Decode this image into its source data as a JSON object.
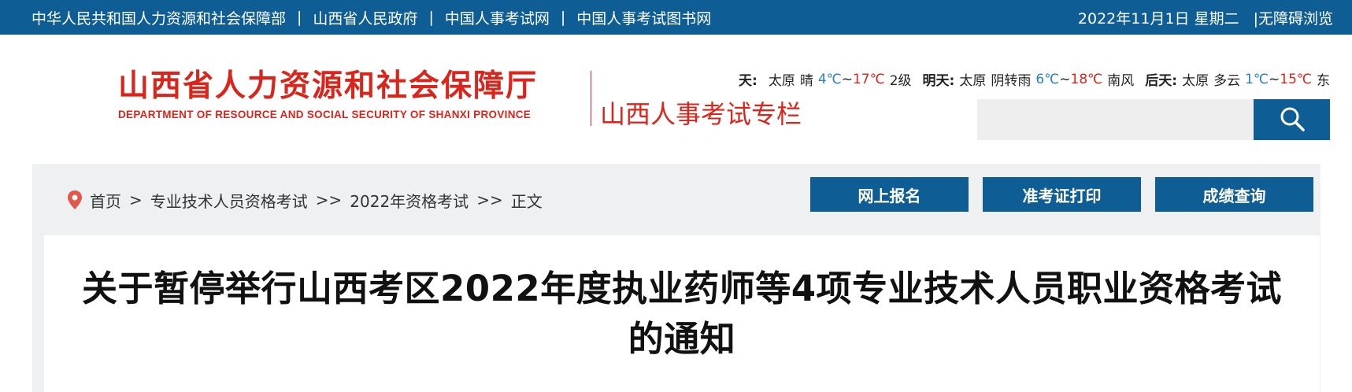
{
  "topbar": {
    "links": [
      "中华人民共和国人力资源和社会保障部",
      "山西省人民政府",
      "中国人事考试网",
      "中国人事考试图书网"
    ],
    "separator": "|",
    "date": "2022年11月1日 星期二",
    "accessibility": "|无障碍浏览"
  },
  "header": {
    "logo_cn": "山西省人力资源和社会保障厅",
    "logo_en": "DEPARTMENT OF RESOURCE AND SOCIAL SECURITY OF SHANXI PROVINCE",
    "logo_sub": "山西人事考试专栏",
    "weather": {
      "partial_label": "天:",
      "today": {
        "city": "太原",
        "cond": "晴",
        "low": "4℃",
        "tilde": "~",
        "high": "17℃",
        "wind": "2级"
      },
      "tomorrow": {
        "label": "明天:",
        "city": "太原",
        "cond": "阴转雨",
        "low": "6℃",
        "tilde": "~",
        "high": "18℃",
        "wind": "南风"
      },
      "after": {
        "label": "后天:",
        "city": "太原",
        "cond": "多云",
        "low": "1℃",
        "tilde": "~",
        "high": "15℃",
        "wind": "东"
      }
    },
    "search": {
      "placeholder": ""
    }
  },
  "breadcrumb": {
    "home": "首页",
    "arrow1": ">",
    "level1": "专业技术人员资格考试",
    "arrow2": ">>",
    "level2": "2022年资格考试",
    "arrow3": ">>",
    "current": "正文"
  },
  "quick_buttons": [
    "网上报名",
    "准考证打印",
    "成绩查询"
  ],
  "article": {
    "title": "关于暂停举行山西考区2022年度执业药师等4项专业技术人员职业资格考试的通知"
  },
  "colors": {
    "brand_blue": "#0e5d95",
    "brand_red": "#d9261c",
    "temp_low": "#2a7fc0",
    "band_gray": "#eef0f2"
  },
  "icons": {
    "location": "location-pin-icon",
    "search": "search-icon"
  }
}
